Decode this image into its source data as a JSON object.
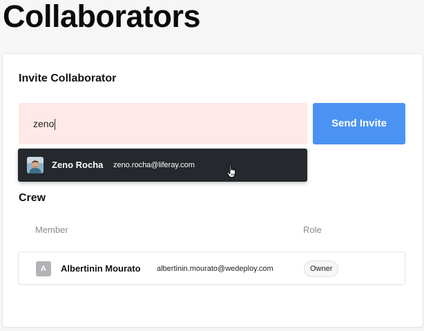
{
  "page": {
    "title": "Collaborators"
  },
  "invite": {
    "heading": "Invite Collaborator",
    "input_value": "zeno",
    "send_button_label": "Send Invite",
    "input_bg_color": "#ffe9e8",
    "button_color": "#4b93f2"
  },
  "suggestion": {
    "name": "Zeno Rocha",
    "email": "zeno.rocha@liferay.com",
    "avatar_icon": "user-photo-icon",
    "bg_color": "#25282c"
  },
  "crew": {
    "heading": "Crew",
    "columns": [
      "Member",
      "Role"
    ],
    "members": [
      {
        "initial": "A",
        "name": "Albertinin Mourato",
        "email": "albertinin.mourato@wedeploy.com",
        "role": "Owner"
      }
    ]
  }
}
